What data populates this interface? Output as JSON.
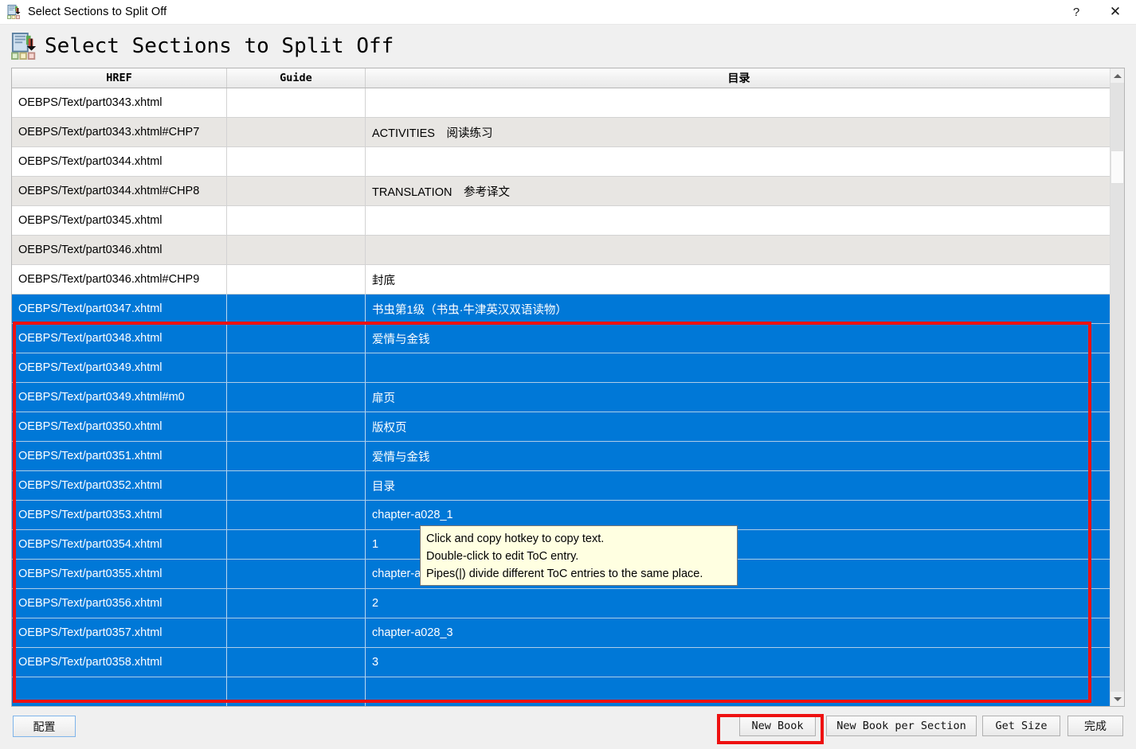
{
  "window": {
    "title": "Select Sections to Split Off",
    "icon": "split-sections-icon",
    "help_label": "?",
    "close_label": "✕"
  },
  "heading": {
    "text": "Select Sections to Split Off",
    "icon": "split-sections-icon"
  },
  "table": {
    "columns": [
      {
        "key": "href",
        "label": "HREF"
      },
      {
        "key": "guide",
        "label": "Guide"
      },
      {
        "key": "toc",
        "label": "目录"
      }
    ],
    "rows": [
      {
        "href": "OEBPS/Text/part0343.xhtml",
        "guide": "",
        "toc": "",
        "selected": false
      },
      {
        "href": "OEBPS/Text/part0343.xhtml#CHP7",
        "guide": "",
        "toc": "ACTIVITIES　阅读练习",
        "selected": false
      },
      {
        "href": "OEBPS/Text/part0344.xhtml",
        "guide": "",
        "toc": "",
        "selected": false
      },
      {
        "href": "OEBPS/Text/part0344.xhtml#CHP8",
        "guide": "",
        "toc": "TRANSLATION　参考译文",
        "selected": false
      },
      {
        "href": "OEBPS/Text/part0345.xhtml",
        "guide": "",
        "toc": "",
        "selected": false
      },
      {
        "href": "OEBPS/Text/part0346.xhtml",
        "guide": "",
        "toc": "",
        "selected": false
      },
      {
        "href": "OEBPS/Text/part0346.xhtml#CHP9",
        "guide": "",
        "toc": "封底",
        "selected": false
      },
      {
        "href": "OEBPS/Text/part0347.xhtml",
        "guide": "",
        "toc": "书虫第1级（书虫·牛津英汉双语读物）",
        "selected": true
      },
      {
        "href": "OEBPS/Text/part0348.xhtml",
        "guide": "",
        "toc": "爱情与金钱",
        "selected": true
      },
      {
        "href": "OEBPS/Text/part0349.xhtml",
        "guide": "",
        "toc": "",
        "selected": true
      },
      {
        "href": "OEBPS/Text/part0349.xhtml#m0",
        "guide": "",
        "toc": "扉页",
        "selected": true
      },
      {
        "href": "OEBPS/Text/part0350.xhtml",
        "guide": "",
        "toc": "版权页",
        "selected": true
      },
      {
        "href": "OEBPS/Text/part0351.xhtml",
        "guide": "",
        "toc": "爱情与金钱",
        "selected": true
      },
      {
        "href": "OEBPS/Text/part0352.xhtml",
        "guide": "",
        "toc": "目录",
        "selected": true
      },
      {
        "href": "OEBPS/Text/part0353.xhtml",
        "guide": "",
        "toc": "chapter-a028_1",
        "selected": true
      },
      {
        "href": "OEBPS/Text/part0354.xhtml",
        "guide": "",
        "toc": "1",
        "selected": true
      },
      {
        "href": "OEBPS/Text/part0355.xhtml",
        "guide": "",
        "toc": "chapter-a028_2",
        "selected": true
      },
      {
        "href": "OEBPS/Text/part0356.xhtml",
        "guide": "",
        "toc": "2",
        "selected": true
      },
      {
        "href": "OEBPS/Text/part0357.xhtml",
        "guide": "",
        "toc": "chapter-a028_3",
        "selected": true
      },
      {
        "href": "OEBPS/Text/part0358.xhtml",
        "guide": "",
        "toc": "3",
        "selected": true
      },
      {
        "href": "",
        "guide": "",
        "toc": "",
        "selected": true
      }
    ]
  },
  "tooltip": {
    "line1": "Click and copy hotkey to copy text.",
    "line2": "Double-click to edit ToC entry.",
    "line3": "Pipes(|) divide different ToC entries to the same place."
  },
  "buttons": {
    "config": "配置",
    "new_book": "New Book",
    "new_book_per_section": "New Book per Section",
    "get_size": "Get Size",
    "done": "完成"
  },
  "colors": {
    "selection_blue": "#0078d7",
    "annotation_red": "#ee1111",
    "tooltip_bg": "#ffffe1",
    "row_alt": "#e8e6e3"
  },
  "scrollbar": {
    "up_arrow": "▲",
    "down_arrow": "▼"
  }
}
